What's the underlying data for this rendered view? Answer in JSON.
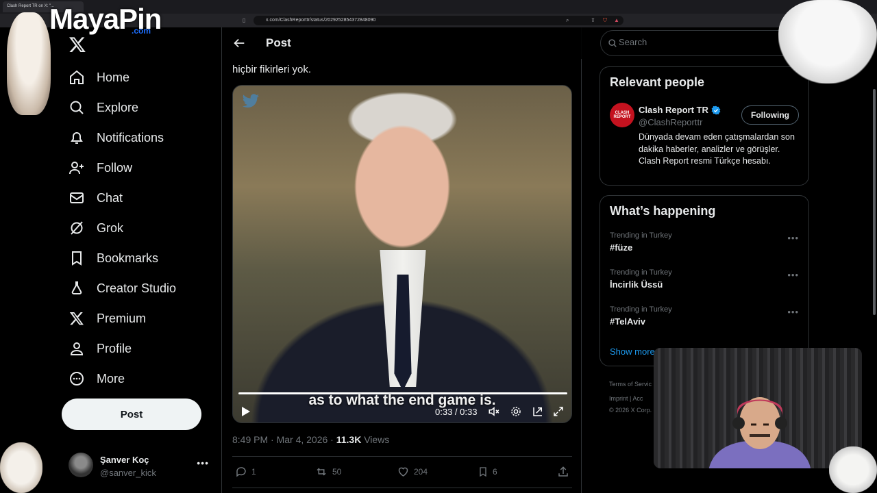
{
  "browser": {
    "tab_title": "Clash Report TR on X: \"...",
    "url": "x.com/ClashReporttr/status/2029252854372848090"
  },
  "overlay": {
    "logo_text": "MayaPin",
    "logo_suffix": ".com"
  },
  "sidebar": {
    "items": [
      {
        "label": "Home",
        "icon": "home-icon"
      },
      {
        "label": "Explore",
        "icon": "search-icon"
      },
      {
        "label": "Notifications",
        "icon": "bell-icon"
      },
      {
        "label": "Follow",
        "icon": "person-add-icon"
      },
      {
        "label": "Chat",
        "icon": "mail-icon"
      },
      {
        "label": "Grok",
        "icon": "grok-icon"
      },
      {
        "label": "Bookmarks",
        "icon": "bookmark-icon"
      },
      {
        "label": "Creator Studio",
        "icon": "flask-icon"
      },
      {
        "label": "Premium",
        "icon": "x-icon"
      },
      {
        "label": "Profile",
        "icon": "person-icon"
      },
      {
        "label": "More",
        "icon": "more-circle-icon"
      }
    ],
    "post_button": "Post",
    "account": {
      "name": "Şanver Koç",
      "handle": "@sanver_kick"
    }
  },
  "main": {
    "header_title": "Post",
    "post_text_visible": "hiçbir fikirleri yok.",
    "video": {
      "caption": "as to what the end game is.",
      "time": "0:33 / 0:33",
      "progress": 1.0
    },
    "meta": {
      "time": "8:49 PM · Mar 4, 2026 · ",
      "views_count": "11.3K",
      "views_label": " Views"
    },
    "actions": {
      "replies": "1",
      "reposts": "50",
      "likes": "204",
      "bookmarks": "6"
    }
  },
  "right": {
    "search_placeholder": "Search",
    "relevant_people": {
      "title": "Relevant people",
      "name": "Clash Report TR",
      "handle": "@ClashReporttr",
      "button": "Following",
      "avatar_text": "CLASH REPORT",
      "bio": "Dünyada devam eden çatışmalardan son dakika haberler, analizler ve görüşler. Clash Report resmi Türkçe hesabı."
    },
    "whats_happening": {
      "title": "What’s happening",
      "trends": [
        {
          "meta": "Trending in Turkey",
          "name": "#füze"
        },
        {
          "meta": "Trending in Turkey",
          "name": "İncirlik Üssü"
        },
        {
          "meta": "Trending in Turkey",
          "name": "#TelAviv"
        }
      ],
      "show_more": "Show more"
    },
    "footer": {
      "line1": "Terms of Servic",
      "line2": "Imprint  |  Acc",
      "line3": "© 2026 X Corp."
    }
  },
  "colors": {
    "accent": "#1d9bf0",
    "verified": "#1d9bf0",
    "background": "#000000",
    "border": "#2f3336",
    "muted": "#71767b"
  }
}
